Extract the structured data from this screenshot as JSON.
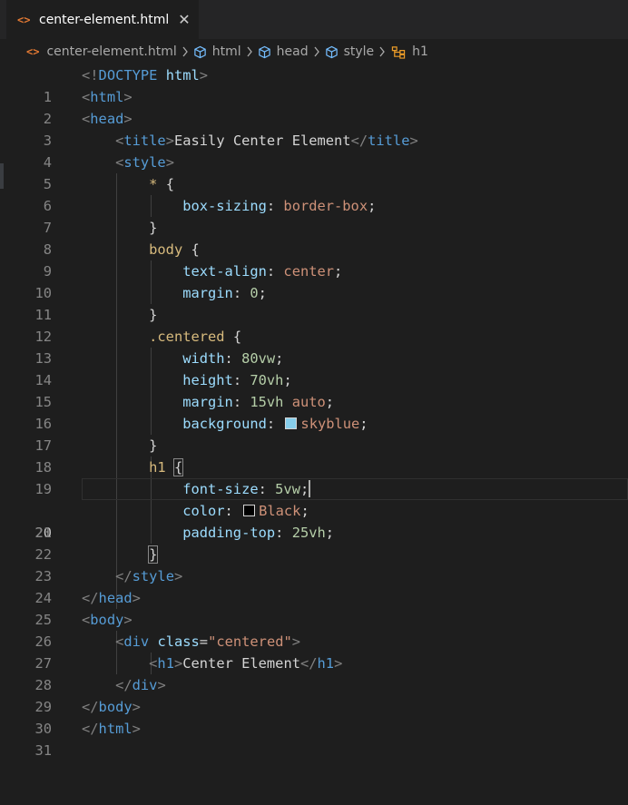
{
  "tab": {
    "icon": "html-file-icon",
    "filename": "center-element.html",
    "close": "✕"
  },
  "breadcrumb": [
    "center-element.html",
    "html",
    "head",
    "style",
    "h1"
  ],
  "editor": {
    "active_line": 20,
    "lines": [
      "<!DOCTYPE html>",
      "<html>",
      "<head>",
      "    <title>Easily Center Element</title>",
      "    <style>",
      "        * {",
      "            box-sizing: border-box;",
      "        }",
      "        body {",
      "            text-align: center;",
      "            margin: 0;",
      "        }",
      "        .centered {",
      "            width: 80vw;",
      "            height: 70vh;",
      "            margin: 15vh auto;",
      "            background: skyblue;",
      "        }",
      "        h1 {",
      "            font-size: 5vw;",
      "            color: Black;",
      "            padding-top: 25vh;",
      "        }",
      "    </style>",
      "</head>",
      "<body>",
      "    <div class=\"centered\">",
      "        <h1>Center Element</h1>",
      "    </div>",
      "</body>",
      "</html>"
    ],
    "colors": {
      "skyblue": "#87ceeb",
      "Black": "#000000"
    }
  }
}
